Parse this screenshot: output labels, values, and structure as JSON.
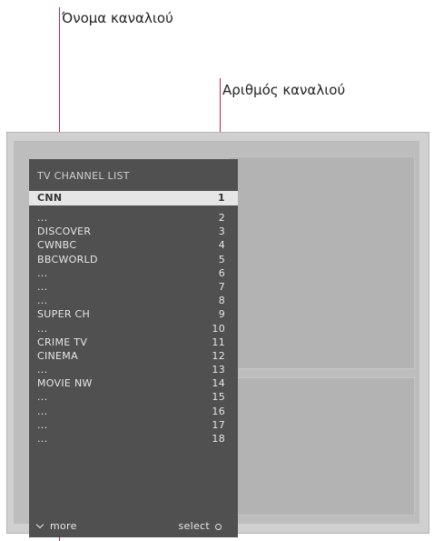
{
  "callouts": {
    "channel_name": "Όνομα καναλιού",
    "channel_number": "Αριθμός καναλιού"
  },
  "menu": {
    "title": "TV CHANNEL LIST",
    "selected": {
      "name": "CNN",
      "number": "1"
    },
    "rows": [
      {
        "name": "...",
        "number": "2"
      },
      {
        "name": "DISCOVER",
        "number": "3"
      },
      {
        "name": "CWNBC",
        "number": "4"
      },
      {
        "name": "BBCWORLD",
        "number": "5"
      },
      {
        "name": "...",
        "number": "6"
      },
      {
        "name": "...",
        "number": "7"
      },
      {
        "name": "...",
        "number": "8"
      },
      {
        "name": "SUPER CH",
        "number": "9"
      },
      {
        "name": "...",
        "number": "10"
      },
      {
        "name": "CRIME TV",
        "number": "11"
      },
      {
        "name": "CINEMA",
        "number": "12"
      },
      {
        "name": "...",
        "number": "13"
      },
      {
        "name": "MOVIE NW",
        "number": "14"
      },
      {
        "name": "...",
        "number": "15"
      },
      {
        "name": "...",
        "number": "16"
      },
      {
        "name": "...",
        "number": "17"
      },
      {
        "name": "...",
        "number": "18"
      }
    ],
    "footer": {
      "more": "more",
      "select": "select"
    }
  },
  "icons": {
    "more": "chevron-down-icon",
    "select": "circle-select-icon"
  },
  "colors": {
    "callout_line": "#b0284a",
    "menu_bg": "#505050",
    "highlight": "#e6e6e6"
  }
}
